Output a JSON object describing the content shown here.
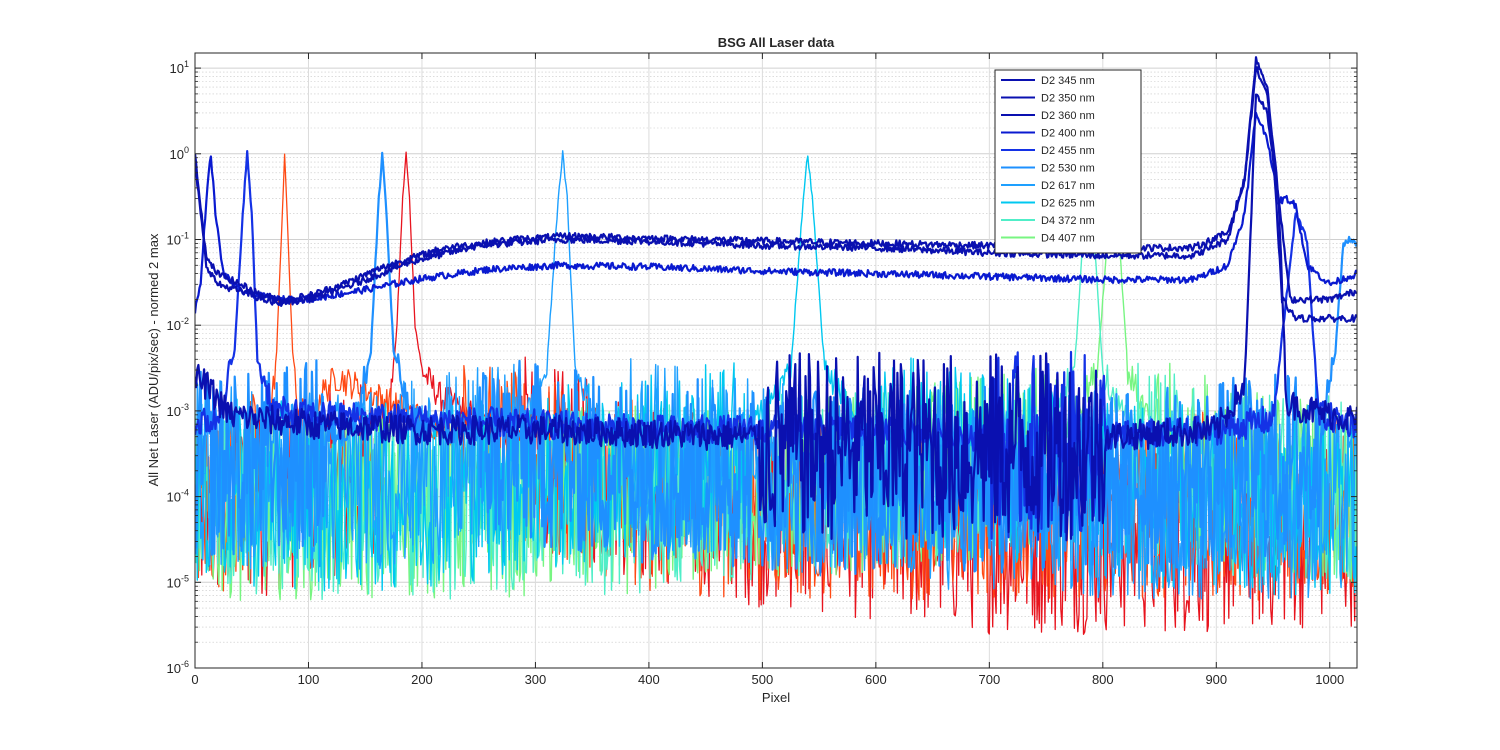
{
  "chart_data": {
    "type": "line",
    "title": "BSG  All Laser data",
    "xlabel": "Pixel",
    "ylabel": "All Net Laser (ADU/pix/sec) - normed 2 max",
    "xlim": [
      0,
      1024
    ],
    "ylim": [
      1e-06,
      15
    ],
    "yscale": "log",
    "grid": true,
    "minor_grid": true,
    "legend_position": "top-right",
    "xticks": [
      {
        "value": 0,
        "label": "0"
      },
      {
        "value": 100,
        "label": "100"
      },
      {
        "value": 200,
        "label": "200"
      },
      {
        "value": 300,
        "label": "300"
      },
      {
        "value": 400,
        "label": "400"
      },
      {
        "value": 500,
        "label": "500"
      },
      {
        "value": 600,
        "label": "600"
      },
      {
        "value": 700,
        "label": "700"
      },
      {
        "value": 800,
        "label": "800"
      },
      {
        "value": 900,
        "label": "900"
      },
      {
        "value": 1000,
        "label": "1000"
      }
    ],
    "yticks": [
      {
        "value": 1e-06,
        "base": "10",
        "exp": "-6"
      },
      {
        "value": 1e-05,
        "base": "10",
        "exp": "-5"
      },
      {
        "value": 0.0001,
        "base": "10",
        "exp": "-4"
      },
      {
        "value": 0.001,
        "base": "10",
        "exp": "-3"
      },
      {
        "value": 0.01,
        "base": "10",
        "exp": "-2"
      },
      {
        "value": 0.1,
        "base": "10",
        "exp": "-1"
      },
      {
        "value": 1,
        "base": "10",
        "exp": "0"
      },
      {
        "value": 10,
        "base": "10",
        "exp": "1"
      }
    ],
    "series": [
      {
        "name": "D2 345 nm",
        "color": "#0a10b0",
        "width": 2.2,
        "points": [
          [
            0,
            1.0
          ],
          [
            5,
            0.25
          ],
          [
            10,
            0.06
          ],
          [
            20,
            0.04
          ],
          [
            40,
            0.03
          ],
          [
            60,
            0.022
          ],
          [
            80,
            0.02
          ],
          [
            100,
            0.022
          ],
          [
            130,
            0.03
          ],
          [
            170,
            0.05
          ],
          [
            220,
            0.08
          ],
          [
            280,
            0.1
          ],
          [
            330,
            0.11
          ],
          [
            380,
            0.105
          ],
          [
            450,
            0.1
          ],
          [
            520,
            0.095
          ],
          [
            600,
            0.09
          ],
          [
            700,
            0.085
          ],
          [
            800,
            0.08
          ],
          [
            880,
            0.08
          ],
          [
            910,
            0.12
          ],
          [
            925,
            0.5
          ],
          [
            935,
            10
          ],
          [
            945,
            5
          ],
          [
            952,
            0.4
          ],
          [
            958,
            0.02
          ],
          [
            970,
            0.012
          ],
          [
            1000,
            0.012
          ],
          [
            1024,
            0.012
          ]
        ]
      },
      {
        "name": "D2 350 nm",
        "color": "#0a10b0",
        "width": 2.2,
        "points": [
          [
            0,
            0.8
          ],
          [
            5,
            0.2
          ],
          [
            10,
            0.05
          ],
          [
            20,
            0.03
          ],
          [
            40,
            0.025
          ],
          [
            70,
            0.018
          ],
          [
            100,
            0.02
          ],
          [
            140,
            0.03
          ],
          [
            190,
            0.055
          ],
          [
            250,
            0.085
          ],
          [
            320,
            0.1
          ],
          [
            400,
            0.095
          ],
          [
            500,
            0.085
          ],
          [
            600,
            0.08
          ],
          [
            700,
            0.07
          ],
          [
            800,
            0.065
          ],
          [
            880,
            0.065
          ],
          [
            910,
            0.1
          ],
          [
            925,
            0.5
          ],
          [
            935,
            13
          ],
          [
            945,
            6
          ],
          [
            955,
            0.3
          ],
          [
            965,
            0.02
          ],
          [
            1000,
            0.02
          ],
          [
            1024,
            0.025
          ]
        ]
      },
      {
        "name": "D2 360 nm",
        "color": "#0a10b0",
        "width": 2.2,
        "points": [
          [
            0,
            0.0025
          ],
          [
            10,
            0.002
          ],
          [
            30,
            0.0009
          ],
          [
            60,
            0.0008
          ],
          [
            100,
            0.0007
          ],
          [
            200,
            0.0006
          ],
          [
            300,
            0.0006
          ],
          [
            400,
            0.00055
          ],
          [
            500,
            0.0005
          ],
          [
            600,
            0.0005
          ],
          [
            700,
            0.0005
          ],
          [
            800,
            0.0005
          ],
          [
            900,
            0.0006
          ],
          [
            925,
            0.002
          ],
          [
            935,
            5
          ],
          [
            945,
            3
          ],
          [
            955,
            0.3
          ],
          [
            962,
            0.0012
          ],
          [
            1000,
            0.0009
          ],
          [
            1024,
            0.0008
          ]
        ]
      },
      {
        "name": "D2 400 nm",
        "color": "#0a1ad0",
        "width": 2.2,
        "points": [
          [
            0,
            0.015
          ],
          [
            5,
            0.03
          ],
          [
            10,
            0.3
          ],
          [
            14,
            1.0
          ],
          [
            18,
            0.2
          ],
          [
            25,
            0.04
          ],
          [
            40,
            0.025
          ],
          [
            70,
            0.02
          ],
          [
            100,
            0.02
          ],
          [
            150,
            0.026
          ],
          [
            200,
            0.035
          ],
          [
            260,
            0.045
          ],
          [
            320,
            0.05
          ],
          [
            400,
            0.048
          ],
          [
            500,
            0.043
          ],
          [
            600,
            0.04
          ],
          [
            700,
            0.037
          ],
          [
            800,
            0.034
          ],
          [
            880,
            0.034
          ],
          [
            910,
            0.05
          ],
          [
            925,
            0.2
          ],
          [
            935,
            3
          ],
          [
            945,
            1.5
          ],
          [
            955,
            0.28
          ],
          [
            962,
            0.3
          ],
          [
            970,
            0.25
          ],
          [
            980,
            0.05
          ],
          [
            1000,
            0.03
          ],
          [
            1024,
            0.04
          ]
        ]
      },
      {
        "name": "D2 455 nm",
        "color": "#1432e6",
        "width": 2.2,
        "points": [
          [
            0,
            0.0007
          ],
          [
            20,
            0.0008
          ],
          [
            35,
            0.005
          ],
          [
            42,
            0.2
          ],
          [
            46,
            1.0
          ],
          [
            50,
            0.2
          ],
          [
            55,
            0.004
          ],
          [
            70,
            0.001
          ],
          [
            100,
            0.0009
          ],
          [
            200,
            0.0008
          ],
          [
            300,
            0.0007
          ],
          [
            400,
            0.0006
          ],
          [
            500,
            0.0006
          ],
          [
            600,
            0.0006
          ],
          [
            700,
            0.0005
          ],
          [
            800,
            0.0005
          ],
          [
            900,
            0.0006
          ],
          [
            950,
            0.0008
          ],
          [
            970,
            0.2
          ],
          [
            980,
            0.1
          ],
          [
            990,
            0.0009
          ],
          [
            1024,
            0.0007
          ]
        ]
      },
      {
        "name": "D2 530 nm",
        "color": "#1e90ff",
        "width": 2.2,
        "points": [
          [
            0,
            0.0003
          ],
          [
            50,
            0.0003
          ],
          [
            100,
            0.0004
          ],
          [
            140,
            0.0007
          ],
          [
            155,
            0.005
          ],
          [
            162,
            0.3
          ],
          [
            165,
            1.0
          ],
          [
            168,
            0.3
          ],
          [
            175,
            0.005
          ],
          [
            190,
            0.0008
          ],
          [
            250,
            0.0005
          ],
          [
            350,
            0.0003
          ],
          [
            450,
            0.00025
          ],
          [
            550,
            0.0002
          ],
          [
            650,
            0.0002
          ],
          [
            750,
            0.0002
          ],
          [
            850,
            0.0002
          ],
          [
            950,
            0.0003
          ],
          [
            990,
            0.0004
          ],
          [
            1005,
            0.005
          ],
          [
            1012,
            0.09
          ],
          [
            1018,
            0.1
          ],
          [
            1024,
            0.09
          ]
        ]
      },
      {
        "name": "D2 617 nm",
        "color": "#1ea0ff",
        "width": 1.4,
        "points": [
          [
            0,
            0.00025
          ],
          [
            100,
            0.0002
          ],
          [
            200,
            0.00025
          ],
          [
            280,
            0.0004
          ],
          [
            310,
            0.003
          ],
          [
            320,
            0.3
          ],
          [
            324,
            1.0
          ],
          [
            328,
            0.3
          ],
          [
            335,
            0.003
          ],
          [
            360,
            0.0006
          ],
          [
            450,
            0.0003
          ],
          [
            600,
            0.00015
          ],
          [
            800,
            0.0001
          ],
          [
            1024,
            0.0001
          ]
        ]
      },
      {
        "name": "D2 625 nm",
        "color": "#00c8f0",
        "width": 1.4,
        "points": [
          [
            0,
            0.00015
          ],
          [
            150,
            0.00012
          ],
          [
            300,
            0.0002
          ],
          [
            480,
            0.0004
          ],
          [
            525,
            0.003
          ],
          [
            536,
            0.3
          ],
          [
            540,
            1.0
          ],
          [
            544,
            0.3
          ],
          [
            555,
            0.003
          ],
          [
            600,
            0.0005
          ],
          [
            700,
            0.0003
          ],
          [
            800,
            0.00015
          ],
          [
            1024,
            0.0001
          ]
        ]
      },
      {
        "name": "D4 372 nm",
        "color": "#50eec8",
        "width": 1.4,
        "points": [
          [
            0,
            0.0001
          ],
          [
            200,
            0.0001
          ],
          [
            400,
            0.00012
          ],
          [
            600,
            0.0002
          ],
          [
            740,
            0.0004
          ],
          [
            775,
            0.003
          ],
          [
            784,
            0.2
          ],
          [
            787,
            0.5
          ],
          [
            791,
            0.2
          ],
          [
            800,
            0.003
          ],
          [
            830,
            0.0004
          ],
          [
            900,
            0.0002
          ],
          [
            1024,
            0.00015
          ]
        ]
      },
      {
        "name": "D4 407 nm",
        "color": "#78f582",
        "width": 1.4,
        "points": [
          [
            0,
            0.0001
          ],
          [
            200,
            0.0001
          ],
          [
            400,
            0.00012
          ],
          [
            600,
            0.0002
          ],
          [
            760,
            0.0004
          ],
          [
            795,
            0.003
          ],
          [
            806,
            0.2
          ],
          [
            809,
            0.5
          ],
          [
            813,
            0.2
          ],
          [
            822,
            0.003
          ],
          [
            850,
            0.0004
          ],
          [
            950,
            0.0002
          ],
          [
            1024,
            0.00015
          ]
        ]
      },
      {
        "name": "",
        "color": "#ff4a14",
        "width": 1.3,
        "points": [
          [
            0,
            0.0001
          ],
          [
            20,
            0.00012
          ],
          [
            40,
            0.00015
          ],
          [
            55,
            0.0002
          ],
          [
            65,
            0.0005
          ],
          [
            72,
            0.005
          ],
          [
            76,
            0.1
          ],
          [
            79,
            1.0
          ],
          [
            82,
            0.1
          ],
          [
            86,
            0.005
          ],
          [
            90,
            0.0012
          ],
          [
            100,
            0.0008
          ],
          [
            110,
            0.0015
          ],
          [
            125,
            0.0025
          ],
          [
            140,
            0.002
          ],
          [
            160,
            0.0015
          ],
          [
            200,
            0.0008
          ],
          [
            250,
            0.0004
          ],
          [
            300,
            0.00025
          ],
          [
            350,
            0.0002
          ],
          [
            400,
            0.00012
          ],
          [
            500,
            0.0001
          ],
          [
            700,
            0.0001
          ],
          [
            900,
            0.0001
          ],
          [
            1024,
            0.0001
          ]
        ]
      },
      {
        "name": "",
        "color": "#e8141e",
        "width": 1.3,
        "points": [
          [
            0,
            8e-05
          ],
          [
            50,
            0.0001
          ],
          [
            100,
            0.00015
          ],
          [
            150,
            0.00025
          ],
          [
            170,
            0.0006
          ],
          [
            178,
            0.01
          ],
          [
            183,
            0.3
          ],
          [
            186,
            1.0
          ],
          [
            189,
            0.3
          ],
          [
            194,
            0.01
          ],
          [
            200,
            0.003
          ],
          [
            215,
            0.0015
          ],
          [
            250,
            0.0008
          ],
          [
            300,
            0.0004
          ],
          [
            350,
            0.00025
          ],
          [
            400,
            0.00015
          ],
          [
            500,
            8e-05
          ],
          [
            700,
            4e-05
          ],
          [
            900,
            4e-05
          ],
          [
            1024,
            5e-05
          ]
        ]
      }
    ]
  }
}
